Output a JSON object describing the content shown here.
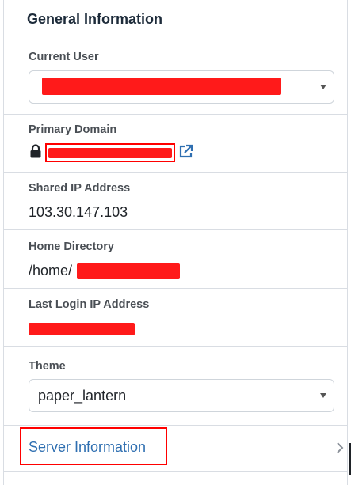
{
  "panel": {
    "title": "General Information",
    "current_user": {
      "label": "Current User",
      "value_redacted": true
    },
    "primary_domain": {
      "label": "Primary Domain",
      "value_redacted": true,
      "icons": [
        "lock-icon",
        "external-link-icon"
      ]
    },
    "shared_ip": {
      "label": "Shared IP Address",
      "value": "103.30.147.103"
    },
    "home_directory": {
      "label": "Home Directory",
      "value_prefix": "/home/",
      "value_redacted": true
    },
    "last_login_ip": {
      "label": "Last Login IP Address",
      "value_redacted": true
    },
    "theme": {
      "label": "Theme",
      "selected": "paper_lantern"
    },
    "server_info": {
      "label": "Server Information"
    }
  },
  "colors": {
    "link": "#2f6fb1",
    "redaction": "#ff0000",
    "border": "#d9dde3"
  }
}
